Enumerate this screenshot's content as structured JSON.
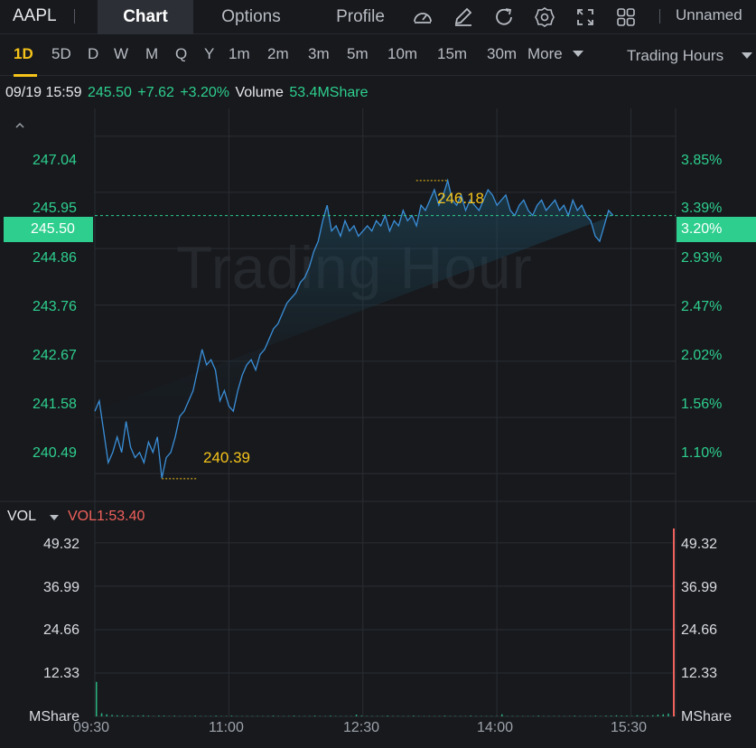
{
  "toolbar": {
    "ticker": "AAPL",
    "tabs": [
      "Chart",
      "Options",
      "Profile"
    ],
    "active_tab": "Chart",
    "icons": [
      "speedometer-icon",
      "draw-icon",
      "refresh-icon",
      "settings-icon",
      "fullscreen-icon",
      "layout-grid-icon"
    ],
    "layout_name": "Unnamed"
  },
  "periods": [
    "1D",
    "5D",
    "D",
    "W",
    "M",
    "Q",
    "Y",
    "1m",
    "2m",
    "3m",
    "5m",
    "10m",
    "15m",
    "30m"
  ],
  "active_period": "1D",
  "more_label": "More",
  "session_label": "Trading Hours",
  "info": {
    "datetime": "09/19 15:59",
    "price": "245.50",
    "change": "+7.62",
    "change_pct": "+3.20%",
    "volume_label": "Volume",
    "volume": "53.4MShare"
  },
  "watermark": "Trading Hour",
  "colors": {
    "up": "#2ecf8e",
    "line": "#3a8fd9",
    "annotation": "#f5c31a",
    "volume_red": "#f0615b",
    "background": "#17191d"
  },
  "chart_data": [
    {
      "type": "line",
      "title": "",
      "x_ticks": [
        "09:30",
        "11:00",
        "12:30",
        "14:00",
        "15:30"
      ],
      "y_ticks_left": [
        "247.04",
        "245.95",
        "244.86",
        "243.76",
        "242.67",
        "241.58",
        "240.49"
      ],
      "y_ticks_right": [
        "3.85%",
        "3.39%",
        "2.93%",
        "2.47%",
        "2.02%",
        "1.56%",
        "1.10%"
      ],
      "ylim": [
        239.95,
        247.58
      ],
      "last_price": "245.50",
      "last_pct": "3.20%",
      "high_label": "246.18",
      "low_label": "240.39",
      "series": [
        {
          "time": [
            "09:30",
            "09:33",
            "09:36",
            "09:39",
            "09:42",
            "09:45",
            "09:48",
            "09:51",
            "09:54",
            "09:57",
            "10:00",
            "10:03",
            "10:06",
            "10:09",
            "10:12",
            "10:15",
            "10:18",
            "10:21",
            "10:24",
            "10:27",
            "10:30",
            "10:33",
            "10:36",
            "10:39",
            "10:42",
            "10:45",
            "10:48",
            "10:51",
            "10:54",
            "10:57",
            "11:00",
            "11:03",
            "11:06",
            "11:09",
            "11:12",
            "11:15",
            "11:18",
            "11:21",
            "11:24",
            "11:27",
            "11:30",
            "11:33",
            "11:36",
            "11:39",
            "11:42",
            "11:45",
            "11:48",
            "11:51",
            "11:54",
            "11:57",
            "12:00",
            "12:03",
            "12:06",
            "12:09",
            "12:12",
            "12:15",
            "12:18",
            "12:21",
            "12:24",
            "12:27",
            "12:30",
            "12:33",
            "12:36",
            "12:39",
            "12:42",
            "12:45",
            "12:48",
            "12:51",
            "12:54",
            "12:57",
            "13:00",
            "13:03",
            "13:06",
            "13:09",
            "13:12",
            "13:15",
            "13:18",
            "13:21",
            "13:24",
            "13:27",
            "13:30",
            "13:33",
            "13:36",
            "13:39",
            "13:42",
            "13:45",
            "13:48",
            "13:51",
            "13:54",
            "13:57",
            "14:00",
            "14:03",
            "14:06",
            "14:09",
            "14:12",
            "14:15",
            "14:18",
            "14:21",
            "14:24",
            "14:27",
            "14:30",
            "14:33",
            "14:36",
            "14:39",
            "14:42",
            "14:45",
            "14:48",
            "14:51",
            "14:54",
            "14:57",
            "15:00",
            "15:03",
            "15:06",
            "15:09",
            "15:12",
            "15:15",
            "15:18",
            "15:21",
            "15:24",
            "15:27",
            "15:30",
            "15:33",
            "15:36",
            "15:39",
            "15:42",
            "15:45",
            "15:48",
            "15:51",
            "15:54",
            "15:57",
            "15:59"
          ],
          "values": [
            241.7,
            241.9,
            241.3,
            240.7,
            240.9,
            241.2,
            240.9,
            241.5,
            241.0,
            240.8,
            240.9,
            240.7,
            241.1,
            240.9,
            241.2,
            240.4,
            240.8,
            240.9,
            241.2,
            241.6,
            241.7,
            241.9,
            242.1,
            242.5,
            242.9,
            242.6,
            242.7,
            242.5,
            241.9,
            242.1,
            241.8,
            241.7,
            242.1,
            242.4,
            242.6,
            242.7,
            242.5,
            242.8,
            242.9,
            243.1,
            243.3,
            243.4,
            243.6,
            243.8,
            243.9,
            244.0,
            244.2,
            244.3,
            244.5,
            244.8,
            245.0,
            245.4,
            245.7,
            245.2,
            245.3,
            245.1,
            245.4,
            245.2,
            245.3,
            245.1,
            245.2,
            245.3,
            245.2,
            245.4,
            245.3,
            245.5,
            245.2,
            245.4,
            245.3,
            245.6,
            245.4,
            245.5,
            245.3,
            245.7,
            245.6,
            245.8,
            246.0,
            245.7,
            245.9,
            246.18,
            245.8,
            245.7,
            245.9,
            245.6,
            245.8,
            245.7,
            245.6,
            245.8,
            246.0,
            245.9,
            245.7,
            245.8,
            245.9,
            245.6,
            245.5,
            245.7,
            245.8,
            245.6,
            245.5,
            245.7,
            245.8,
            245.6,
            245.7,
            245.8,
            245.6,
            245.7,
            245.5,
            245.8,
            245.6,
            245.7,
            245.5,
            245.4,
            245.1,
            245.0,
            245.3,
            245.6,
            245.5
          ]
        }
      ]
    },
    {
      "type": "bar",
      "title": "VOL",
      "indicator_label": "VOL1:53.40",
      "unit": "MShare",
      "y_ticks": [
        "49.32",
        "36.99",
        "24.66",
        "12.33"
      ],
      "ylim": [
        0,
        53.4
      ],
      "x_ticks": [
        "09:30",
        "11:00",
        "12:30",
        "14:00",
        "15:30"
      ],
      "values": [
        9.8,
        0.9,
        0.6,
        0.4,
        0.3,
        0.3,
        0.2,
        0.2,
        0.2,
        0.3,
        0.2,
        0.1,
        0.2,
        0.2,
        0.1,
        0.2,
        0.1,
        0.1,
        0.1,
        0.2,
        0.1,
        0.1,
        0.1,
        0.2,
        0.1,
        0.1,
        0.2,
        0.1,
        0.1,
        0.1,
        0.1,
        0.1,
        0.1,
        0.1,
        0.2,
        0.1,
        0.1,
        0.1,
        0.2,
        0.1,
        0.1,
        0.1,
        0.2,
        0.1,
        0.1,
        0.2,
        0.1,
        0.1,
        0.1,
        0.1,
        0.5,
        0.2,
        0.1,
        0.1,
        0.1,
        0.1,
        0.2,
        0.1,
        0.1,
        0.1,
        0.1,
        0.2,
        0.1,
        0.1,
        0.1,
        0.1,
        0.1,
        0.2,
        0.1,
        0.1,
        0.1,
        0.1,
        0.2,
        0.1,
        0.1,
        0.1,
        0.1,
        0.1,
        0.6,
        0.1,
        0.1,
        0.1,
        0.1,
        0.1,
        0.1,
        0.2,
        0.1,
        0.1,
        0.1,
        0.1,
        0.1,
        0.1,
        0.2,
        0.1,
        0.1,
        0.1,
        0.2,
        0.1,
        0.2,
        0.2,
        0.3,
        0.2,
        0.2,
        0.1,
        0.3,
        0.2,
        0.2,
        0.3,
        0.5,
        0.6,
        0.8,
        53.4
      ],
      "last_bar_color": "#f0615b"
    }
  ]
}
